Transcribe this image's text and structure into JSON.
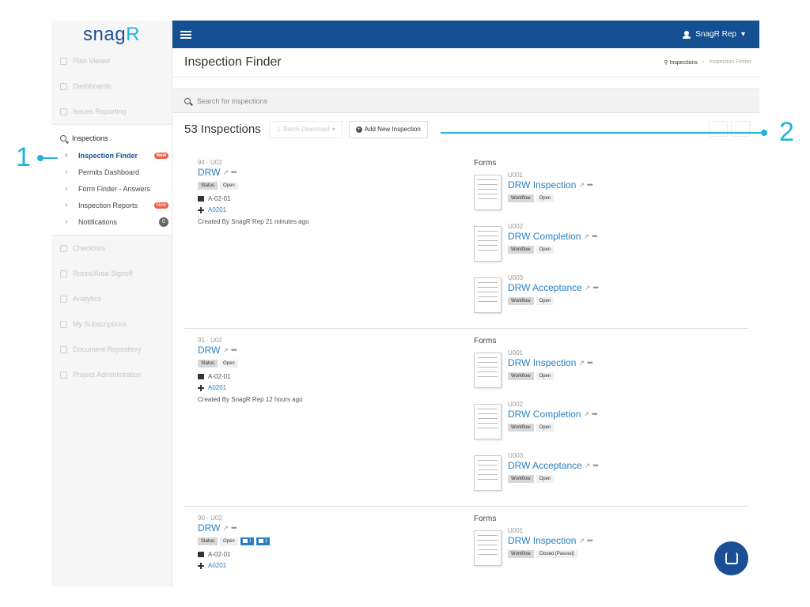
{
  "sidebar": {
    "logo_main": "snag",
    "logo_accent": "R",
    "top_items": [
      "Plan Viewer",
      "Dashboards",
      "Issues Reporting"
    ],
    "section_title": "Inspections",
    "sub_items": [
      {
        "label": "Inspection Finder",
        "badge": "New"
      },
      {
        "label": "Permits Dashboard",
        "badge": ""
      },
      {
        "label": "Form Finder - Answers",
        "badge": ""
      },
      {
        "label": "Inspection Reports",
        "badge": "New"
      },
      {
        "label": "Notifications",
        "badge": "0"
      }
    ],
    "bottom_items": [
      "Checklists",
      "Room/Area Signoff",
      "Analytics",
      "My Subscriptions",
      "Document Repository",
      "Project Administration"
    ]
  },
  "topbar": {
    "user": "SnagR Rep",
    "caret": "▾"
  },
  "page": {
    "title": "Inspection Finder",
    "crumb1": "Inspections",
    "crumb2": "Inspection Finder"
  },
  "search": {
    "placeholder": "Search for inspections"
  },
  "list": {
    "count": "53 Inspections",
    "batch": "Batch Download",
    "add": "Add New Inspection"
  },
  "records": [
    {
      "id": "94 · U02",
      "name": "DRW",
      "status_label": "Status",
      "status": "Open",
      "location": "A-02-01",
      "room": "A0201",
      "created": "Created By SnagR Rep 21 minutes ago",
      "forms_title": "Forms",
      "forms": [
        {
          "id": "U001",
          "name": "DRW Inspection",
          "wf_label": "Workflow",
          "wf": "Open"
        },
        {
          "id": "U002",
          "name": "DRW Completion",
          "wf_label": "Workflow",
          "wf": "Open"
        },
        {
          "id": "U003",
          "name": "DRW Acceptance",
          "wf_label": "Workflow",
          "wf": "Open"
        }
      ]
    },
    {
      "id": "91 · U02",
      "name": "DRW",
      "status_label": "Status",
      "status": "Open",
      "location": "A-02-01",
      "room": "A0201",
      "created": "Created By SnagR Rep 12 hours ago",
      "forms_title": "Forms",
      "forms": [
        {
          "id": "U001",
          "name": "DRW Inspection",
          "wf_label": "Workflow",
          "wf": "Open"
        },
        {
          "id": "U002",
          "name": "DRW Completion",
          "wf_label": "Workflow",
          "wf": "Open"
        },
        {
          "id": "U003",
          "name": "DRW Acceptance",
          "wf_label": "Workflow",
          "wf": "Open"
        }
      ]
    },
    {
      "id": "90 · U02",
      "name": "DRW",
      "status_label": "Status",
      "status": "Open",
      "folder_count": "1",
      "pin_count": "3",
      "location": "A-02-01",
      "room": "A0201",
      "forms_title": "Forms",
      "forms": [
        {
          "id": "U001",
          "name": "DRW Inspection",
          "wf_label": "Workflow",
          "wf": "Closed (Passed)"
        }
      ]
    }
  ],
  "callouts": {
    "one": "1",
    "two": "2"
  }
}
